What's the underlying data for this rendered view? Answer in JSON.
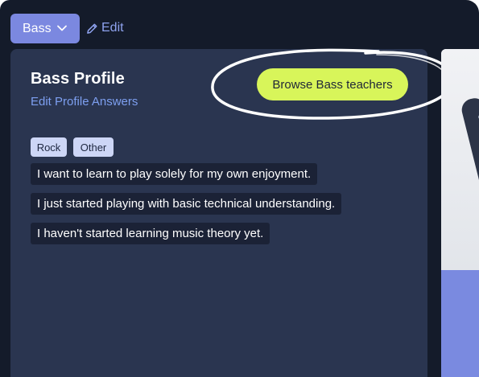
{
  "header": {
    "instrument_selected": "Bass",
    "edit_label": "Edit"
  },
  "profile": {
    "title": "Bass Profile",
    "edit_answers_label": "Edit Profile Answers",
    "browse_button_label": "Browse Bass teachers",
    "genres": [
      "Rock",
      "Other"
    ],
    "answers": [
      "I want to learn to play solely for my own enjoyment.",
      "I just started playing with basic technical understanding.",
      "I haven't started learning music theory yet."
    ]
  },
  "colors": {
    "background": "#141b2a",
    "panel": "#2a3550",
    "dropdown": "#7b88e0",
    "link": "#8fa3ef",
    "cta": "#d8f55a",
    "tag": "#cdd6f6",
    "answer_chip": "#1b2236"
  },
  "icons": {
    "dropdown": "chevron-down-icon",
    "edit": "pencil-icon"
  }
}
